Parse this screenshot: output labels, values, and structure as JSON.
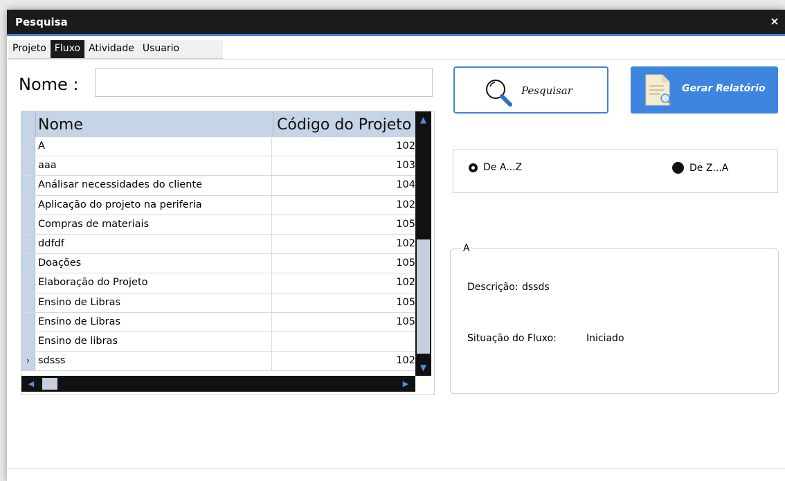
{
  "window": {
    "title": "Pesquisa",
    "close_glyph": "×"
  },
  "tabs": [
    {
      "label": "Projeto",
      "active": false
    },
    {
      "label": "Fluxo",
      "active": true
    },
    {
      "label": "Atividade",
      "active": false
    },
    {
      "label": "Usuario",
      "active": false
    }
  ],
  "search": {
    "label": "Nome :",
    "value": ""
  },
  "grid": {
    "columns": [
      "Nome",
      "Código do Projeto"
    ],
    "rows": [
      {
        "nome": "A",
        "codigo": "102"
      },
      {
        "nome": "aaa",
        "codigo": "103"
      },
      {
        "nome": "Análisar necessidades do cliente",
        "codigo": "104"
      },
      {
        "nome": "Aplicação do projeto na periferia",
        "codigo": "102"
      },
      {
        "nome": "Compras de materiais",
        "codigo": "105"
      },
      {
        "nome": "ddfdf",
        "codigo": "102"
      },
      {
        "nome": "Doações",
        "codigo": "105"
      },
      {
        "nome": "Elaboração do Projeto",
        "codigo": "102"
      },
      {
        "nome": "Ensino de Libras",
        "codigo": "105"
      },
      {
        "nome": "Ensino de Libras",
        "codigo": "105"
      },
      {
        "nome": "Ensino de libras",
        "codigo": ""
      },
      {
        "nome": "sdsss",
        "codigo": "102",
        "current": true
      }
    ],
    "row_marker": "›"
  },
  "buttons": {
    "pesquisar": "Pesquisar",
    "relatorio": "Gerar Relatório"
  },
  "sort": {
    "asc_label": "De A...Z",
    "desc_label": "De Z...A",
    "selected": "asc"
  },
  "detail": {
    "group_title": "A",
    "descricao_label": "Descrição:",
    "descricao_value": "dssds",
    "situacao_label": "Situação do Fluxo:",
    "situacao_value": "Iniciado"
  },
  "colors": {
    "accent": "#3e82d9",
    "titlebar": "#1b1b1b",
    "grid_header": "#c5d4e6"
  },
  "icons": {
    "pesquisar": "magnifier-icon",
    "relatorio": "report-document-icon",
    "close": "close-icon"
  }
}
